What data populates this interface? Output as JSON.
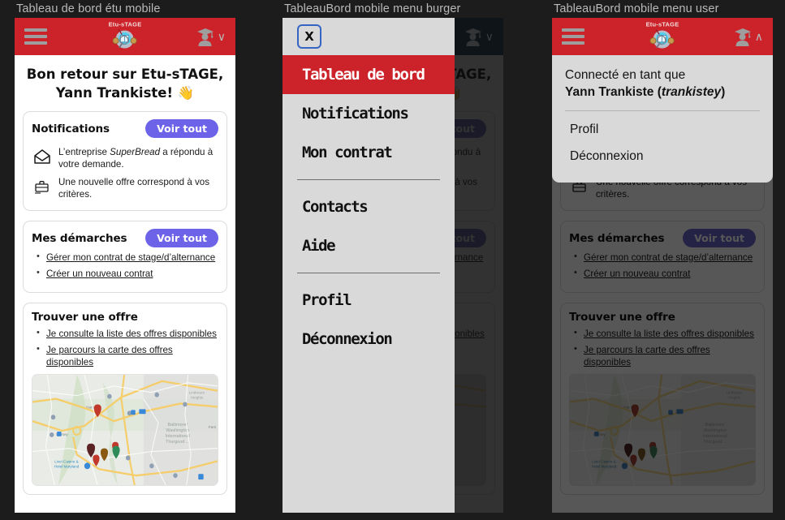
{
  "panels": [
    {
      "title": "Tableau de bord étu mobile"
    },
    {
      "title": "TableauBord mobile menu burger"
    },
    {
      "title": "TableauBord mobile menu user"
    }
  ],
  "header": {
    "logo_word": "Etu-sTAGE",
    "burger_icon": "hamburger-menu-icon",
    "logo_icon": "etu-stage-logo-icon",
    "user_icon": "graduate-user-icon",
    "chevron_down": "∨",
    "chevron_up": "∧"
  },
  "dashboard": {
    "welcome_line1": "Bon retour sur Etu-sTAGE,",
    "welcome_line2": "Yann Trankiste! 👋",
    "notifications": {
      "title": "Notifications",
      "see_all": "Voir tout",
      "items": [
        {
          "icon": "envelope-icon",
          "text_pre": "L’entreprise ",
          "text_em": "SuperBread",
          "text_post": " a répondu à votre demande."
        },
        {
          "icon": "briefcase-icon",
          "text_pre": "Une nouvelle offre correspond à vos critères.",
          "text_em": "",
          "text_post": ""
        }
      ]
    },
    "demarches": {
      "title": "Mes démarches",
      "see_all": "Voir tout",
      "links": [
        "Gérer mon contrat de stage/d’alternance",
        "Créer un nouveau contrat"
      ]
    },
    "offres": {
      "title": "Trouver une offre",
      "links": [
        "Je consulte la liste des offres disponibles",
        "Je parcours la carte des offres disponibles"
      ],
      "map": {
        "icon": "map-widget",
        "labels": [
          "Hanover",
          "Dorsey",
          "Baltimore/ Washington International Thurgood ...",
          "Linthicum Heights",
          "Live! Casino & Hotel Maryland",
          "Ferndale"
        ],
        "markers": [
          "#c0392b",
          "#5b2323",
          "#c0392b",
          "#8a5a12",
          "#c0392b",
          "#2e8b57"
        ]
      }
    }
  },
  "burger_menu": {
    "close_label": "X",
    "groups": [
      {
        "items": [
          {
            "label": "Tableau de bord",
            "active": true
          },
          {
            "label": "Notifications",
            "active": false
          },
          {
            "label": "Mon contrat",
            "active": false
          }
        ]
      },
      {
        "items": [
          {
            "label": "Contacts",
            "active": false
          },
          {
            "label": "Aide",
            "active": false
          }
        ]
      },
      {
        "items": [
          {
            "label": "Profil",
            "active": false
          },
          {
            "label": "Déconnexion",
            "active": false
          }
        ]
      }
    ]
  },
  "user_menu": {
    "connected_as": "Connecté en tant que",
    "user_name": "Yann Trankiste",
    "user_login": "trankistey",
    "items": [
      "Profil",
      "Déconnexion"
    ]
  },
  "colors": {
    "header_red": "#cc2229",
    "accent_purple": "#6c63e8",
    "drawer_grey": "#d9d9d9",
    "page_bg": "#1c1c1c",
    "focus_blue": "#3465c4"
  }
}
